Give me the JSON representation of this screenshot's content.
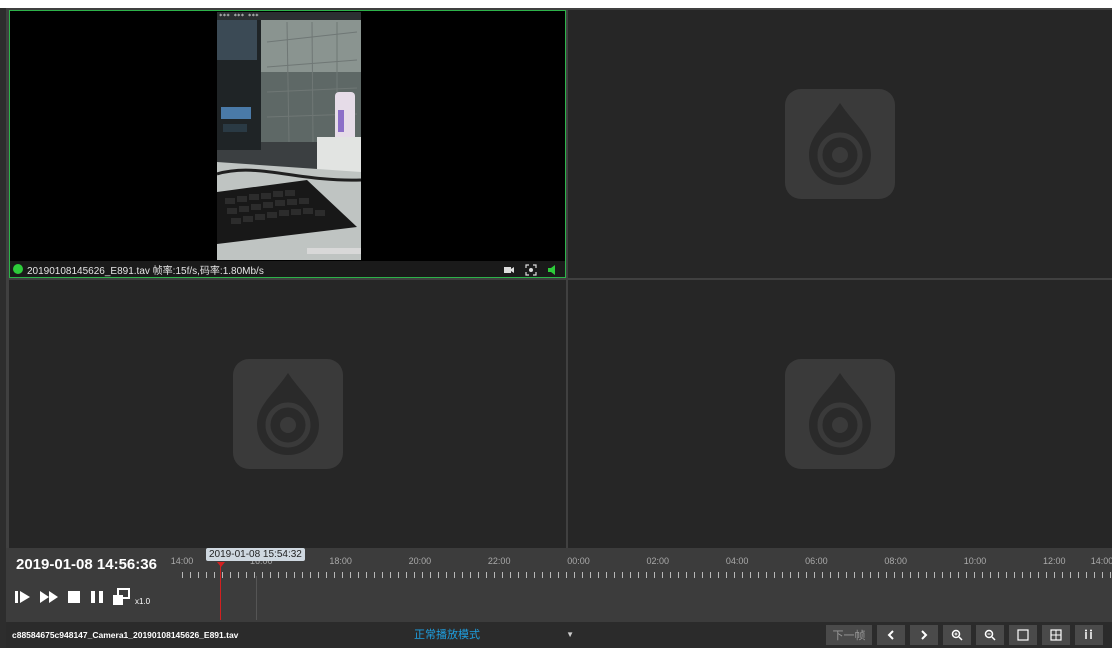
{
  "video": {
    "status_text": "20190108145626_E891.tav 帧率:15f/s,码率:1.80Mb/s",
    "active_color": "#2db24a",
    "icons": [
      "record-icon",
      "capture-icon",
      "audio-icon"
    ]
  },
  "timeline": {
    "current_time": "2019-01-08 14:56:36",
    "cursor_time": "2019-01-08 15:54:32",
    "ticks": [
      "14:00",
      "16:00",
      "18:00",
      "20:00",
      "22:00",
      "00:00",
      "02:00",
      "04:00",
      "06:00",
      "08:00",
      "10:00",
      "12:00",
      "14:00"
    ]
  },
  "controls": {
    "speed": "x1.0",
    "icons": [
      "step-play-icon",
      "fast-forward-icon",
      "stop-icon",
      "pause-icon",
      "multi-window-icon"
    ]
  },
  "bottom": {
    "filename": "c88584675c948147_Camera1_20190108145626_E891.tav",
    "mode": "正常播放模式",
    "next_frame": "下一帧",
    "icons": [
      "prev-icon",
      "next-icon",
      "zoom-in-icon",
      "zoom-out-icon",
      "single-layout-icon",
      "quad-layout-icon",
      "more-layout-icon"
    ]
  }
}
